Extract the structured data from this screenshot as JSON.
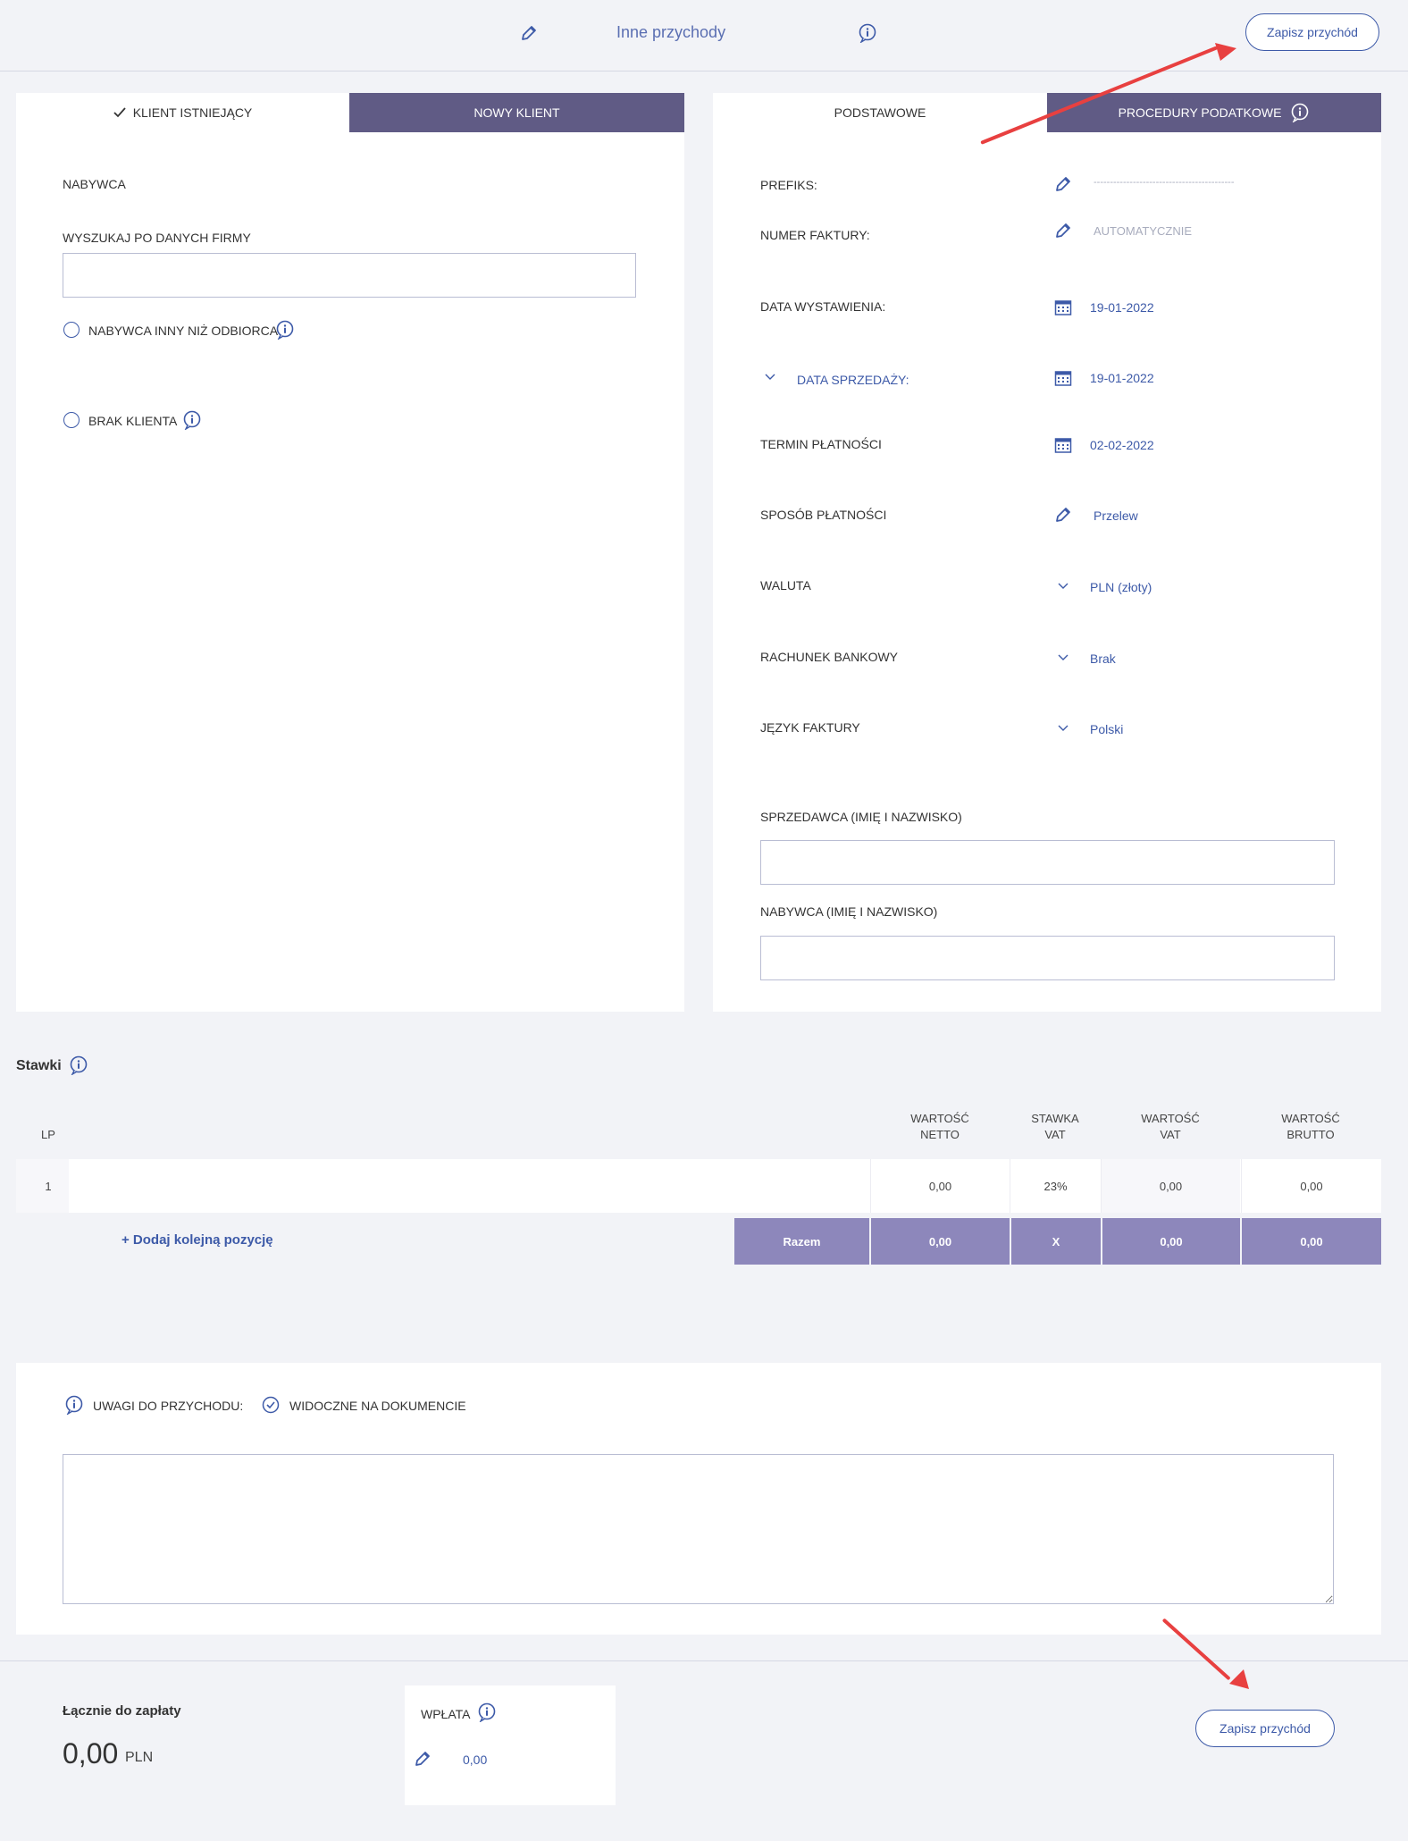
{
  "header": {
    "title": "Inne przychody",
    "save_button": "Zapisz przychód"
  },
  "client": {
    "tab_existing": "KLIENT ISTNIEJĄCY",
    "tab_new": "NOWY KLIENT",
    "buyer_label": "NABYWCA",
    "search_label": "WYSZUKAJ PO DANYCH FIRMY",
    "search_value": "",
    "option_other_receiver": "NABYWCA INNY NIŻ ODBIORCA",
    "option_no_client": "BRAK KLIENTA"
  },
  "invoice": {
    "tab_basic": "PODSTAWOWE",
    "tab_tax": "PROCEDURY PODATKOWE",
    "prefix_label": "PREFIKS:",
    "prefix_value": "-------------------------------------------",
    "number_label": "NUMER FAKTURY:",
    "number_value": "AUTOMATYCZNIE",
    "issue_date_label": "DATA WYSTAWIENIA:",
    "issue_date_value": "19-01-2022",
    "sale_date_label": "DATA SPRZEDAŻY:",
    "sale_date_value": "19-01-2022",
    "payment_term_label": "TERMIN PŁATNOŚCI",
    "payment_term_value": "02-02-2022",
    "payment_method_label": "SPOSÓB PŁATNOŚCI",
    "payment_method_value": "Przelew",
    "currency_label": "WALUTA",
    "currency_value": "PLN (złoty)",
    "bank_label": "RACHUNEK BANKOWY",
    "bank_value": "Brak",
    "language_label": "JĘZYK FAKTURY",
    "language_value": "Polski",
    "seller_name_label": "SPRZEDAWCA (IMIĘ I NAZWISKO)",
    "buyer_name_label": "NABYWCA (IMIĘ I NAZWISKO)"
  },
  "rates": {
    "title": "Stawki",
    "col_lp": "LP",
    "col_net_1": "WARTOŚĆ",
    "col_net_2": "NETTO",
    "col_rate_1": "STAWKA",
    "col_rate_2": "VAT",
    "col_vat_1": "WARTOŚĆ",
    "col_vat_2": "VAT",
    "col_gross_1": "WARTOŚĆ",
    "col_gross_2": "BRUTTO",
    "row": {
      "lp": "1",
      "net": "0,00",
      "rate": "23%",
      "vat": "0,00",
      "gross": "0,00"
    },
    "add_position": "+ Dodaj kolejną pozycję",
    "sum_label": "Razem",
    "sum_net": "0,00",
    "sum_rate": "X",
    "sum_vat": "0,00",
    "sum_gross": "0,00"
  },
  "notes": {
    "label": "UWAGI DO PRZYCHODU:",
    "visible_label": "WIDOCZNE NA DOKUMENCIE",
    "text": ""
  },
  "footer": {
    "total_label": "Łącznie do zapłaty",
    "total_value": "0,00",
    "total_currency": "PLN",
    "payment_label": "WPŁATA",
    "payment_value": "0,00",
    "save_button": "Zapisz przychód"
  },
  "colors": {
    "accent": "#3d5aa8",
    "tab_inactive": "#605b85",
    "sum_row": "#8d87bb",
    "annotation_arrow": "#e84040",
    "background": "#f2f3f7"
  },
  "icons": [
    "pencil-icon",
    "info-icon",
    "calendar-icon",
    "chevron-down-icon",
    "check-icon",
    "check-circle-icon"
  ]
}
